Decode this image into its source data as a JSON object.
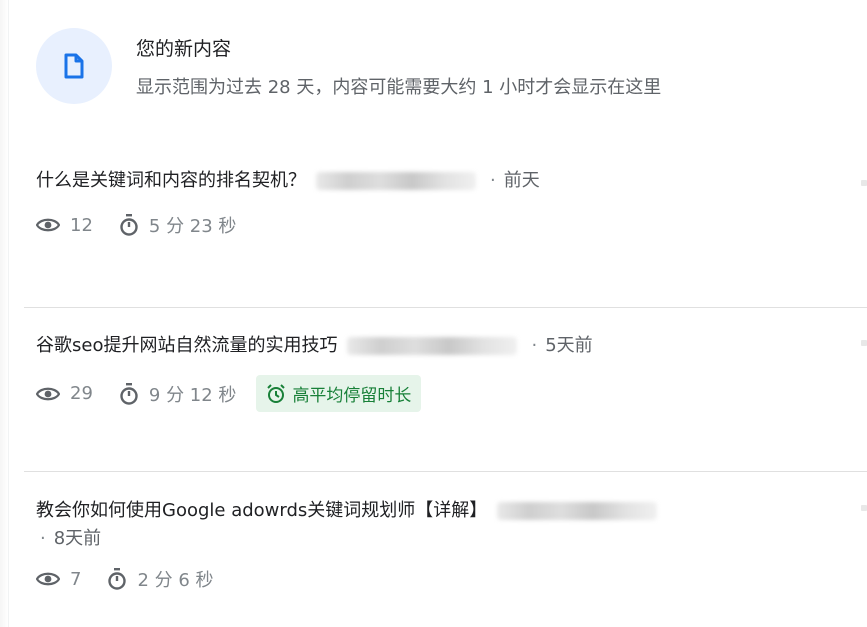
{
  "header": {
    "icon": "document-icon",
    "title": "您的新内容",
    "subtitle": "显示范围为过去 28 天，内容可能需要大约 1 小时才会显示在这里"
  },
  "items": [
    {
      "title": "什么是关键词和内容的排名契机？",
      "date": "前天",
      "views": "12",
      "duration": "5 分 23 秒",
      "badge": ""
    },
    {
      "title": "谷歌seo提升网站自然流量的实用技巧",
      "date": "5天前",
      "views": "29",
      "duration": "9 分 12 秒",
      "badge": "高平均停留时长"
    },
    {
      "title": "教会你如何使用Google adowrds关键词规划师【详解】",
      "date": "8天前",
      "views": "7",
      "duration": "2 分 6 秒",
      "badge": ""
    }
  ],
  "separator": "·",
  "colors": {
    "accent": "#1a73e8",
    "badge_bg": "#e6f4ea",
    "badge_text": "#188038",
    "muted": "#80868b"
  }
}
